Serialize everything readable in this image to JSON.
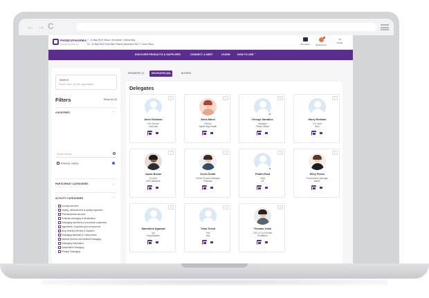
{
  "browser": {
    "back_icon": "arrow-left-icon",
    "forward_icon": "arrow-right-icon",
    "reload_icon": "reload-icon",
    "menu_icon": "hamburger-menu-icon"
  },
  "header": {
    "logo_text": "PHINEXPHARMA",
    "logo_sub": "connecting pharma",
    "event_line1_date": "7 - 11 May 2022",
    "event_line1_text": "Virtual • Innovation • Networking",
    "event_line2_date": "10 - 11 May 2022",
    "event_line2_text": "Feria Baix Pharma Barcelona Hall 7.1 Gran Plaza",
    "messages_label": "Messages",
    "notifications_label": "Notifications",
    "profile_label": "Profile"
  },
  "nav": {
    "items": [
      "DISCOVER PRODUCTS & SUPPLIERS",
      "CONNECT & MEET",
      "LEARN",
      "HOW TO USE"
    ]
  },
  "sidebar": {
    "search_title": "SEARCH",
    "search_placeholder": "Search name, job title, organization...",
    "filters_title": "Filters",
    "reset_label": "Reset all (0)",
    "countries_label": "COUNTRIES",
    "country_search_placeholder": "Search country",
    "country_item": "Americas, Various",
    "participant_categories_label": "PARTICIPANT CATEGORIES",
    "activity_categories_label": "ACTIVITY CATEGORIES",
    "categories": [
      "Contract services",
      "Testing, measurement & quality inspection",
      "Pharmaceutical services",
      "Software packaging & serialization",
      "Packaging machinery & production equipment",
      "Ingredients, excipients and components",
      "Drug Delivery Devices & Systems",
      "Packaging Materials & Components",
      "Medical Devices and Medical Packaging",
      "Packaging Automation",
      "Sustainable Packaging",
      "Primary Packaging"
    ]
  },
  "tabs": [
    {
      "label": "SPEAKERS (7)",
      "active": false
    },
    {
      "label": "DELEGATES (33)",
      "active": true
    },
    {
      "label": "BUYERS",
      "active": false
    }
  ],
  "panel_title": "Delegates",
  "delegates": [
    {
      "name": "Anne Hickman",
      "role": "Info Service",
      "org": "InfoLinks",
      "photo": "placeholder",
      "online": false
    },
    {
      "name": "Anna Morel",
      "role": "Partner",
      "org": "Aspire Bay Health",
      "photo": "woman-red-hair",
      "online": false
    },
    {
      "name": "George Saradiuc",
      "role": "Manager",
      "org": "Pfizer Global",
      "photo": "placeholder",
      "online": true
    },
    {
      "name": "Harry Redman",
      "role": "UX Lead",
      "org": "AVO",
      "photo": "placeholder",
      "online": false
    },
    {
      "name": "Jacob Brown",
      "role": "Ex Area",
      "org": "KBC Medicine",
      "photo": "man-dark",
      "online": false
    },
    {
      "name": "Kevin Smith",
      "role": "Senior Product Manager",
      "org": "PedKare",
      "photo": "man-suit",
      "online": false
    },
    {
      "name": "Pradhi Pant",
      "role": "VMA",
      "org": "CP",
      "photo": "placeholder",
      "online": true
    },
    {
      "name": "Riley Peters",
      "role": "Procurement Manager",
      "org": "MediX",
      "photo": "woman-brown-hair",
      "online": false
    },
    {
      "name": "Samridchi Agarwal",
      "role": "xyz",
      "org": "ExpoAdditive",
      "photo": "placeholder",
      "online": false
    },
    {
      "name": "Tesla Tessit",
      "role": "Test",
      "org": "test",
      "photo": "placeholder",
      "online": false
    },
    {
      "name": "Thomas Yoshi",
      "role": "CEO & Co-Founder",
      "org": "PhotBinco",
      "photo": "man-grey-suit",
      "online": false
    }
  ],
  "icons": {
    "card_star": "star-icon",
    "card_meeting": "calendar-icon",
    "card_message": "message-icon"
  },
  "colors": {
    "brand": "#5c2c91",
    "online": "#3cbf5c"
  }
}
